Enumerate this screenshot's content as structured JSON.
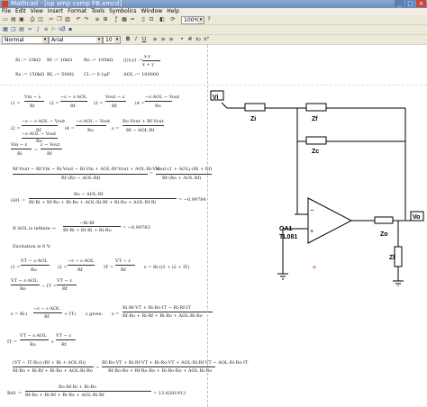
{
  "window": {
    "title": "Mathcad - [op amp comp FB.xmcd]"
  },
  "menu": [
    "File",
    "Edit",
    "View",
    "Insert",
    "Format",
    "Tools",
    "Symbolics",
    "Window",
    "Help"
  ],
  "toolbar": {
    "zoom": "100%",
    "style": "Normal",
    "font": "Arial",
    "size": "10",
    "bold": "B",
    "italic": "I",
    "underline": "U"
  },
  "defs": {
    "Ri": "Ri := 10kΩ",
    "Rf": "Rf := 10kΩ",
    "Ro": "Ro := 100kΩ",
    "par": "||(x,y) :=",
    "par_num": "x·y",
    "par_den": "x + y",
    "Rs": "Rs := 150kΩ",
    "RL": "RL := 500Ω",
    "Cl": "Cl := 0.1µF",
    "AOL": "AOL := 100000"
  },
  "eqs": {
    "i1": "i1 =",
    "i1n": "Vin − ε",
    "i1d": "Ri",
    "i2": "i2 =",
    "i2n": "−ε − ε·AOL",
    "i2d": "Rf",
    "i3": "i3 =",
    "i3n": "Vout − ε",
    "i3d": "Rf",
    "i4": "i4 =",
    "i4n": "−ε·AOL − Vout",
    "i4d": "Ro",
    "r2a": "i2 =",
    "r2an": "−ε − ε·AOL − Vout",
    "r2ad": "Rf",
    "r2b": "i4 =",
    "r2bn": "−ε·AOL − Vout",
    "r2bd": "Ro",
    "r2c": "ε =",
    "r2cn": "Ro·Vout + Rf·Vout",
    "r2cd": "Rf − AOL·Rf",
    "r3n": "Vin − ε",
    "r3d": "Ri",
    "r3e": "=",
    "r3n2": "ε − Vout",
    "r3d2": "Rf",
    "big1n": "Rf·Vout − Rf·Vin − Ri·Vout − Ri·Vin + AOL·Rf·Vout + AOL·Ri·Vin",
    "big1d": "Rf·(Ro − AOL·Rf)",
    "big1r": "Vout·(1 + AOL)·(Ri + Rf)",
    "big1rd": "Rf·(Ro + AOL·Rf)",
    "g": "G01 =",
    "gn": "Ro − AOL·Rf",
    "gd": "Rf·Ri + Rf·Ro + Ri·Ro + AOL·Ri·Rf + Ri·Ro + AOL·Rf·Ri",
    "gres": "= −0.99784",
    "aol": "If AOL is infinite →",
    "aoln": "−Ri·Rf",
    "aold": "Rf·Ri + Rf·Ri + Ri·Ro",
    "aolres": "= −0.99783",
    "exc": "Excitation is 0 V:",
    "e1": "i1 =",
    "e1n": "VT − ε·AOL",
    "e1d": "Ro",
    "e2": "i2 =",
    "e2n": "−ε − ε·AOL",
    "e2d": "Rf",
    "e3": "IT =",
    "e3n": "VT − ε",
    "e3d": "Rf",
    "e4": "ε = Ri·(i1 + i2 + IT)",
    "f1n": "VT − ε·AOL",
    "f1d": "Ro",
    "f1m": "− IT =",
    "f1n2": "VT − ε",
    "f1d2": "Rf",
    "f2": "ε = Ri·(",
    "f2n": "−ε − ε·AOL",
    "f2d": "Rf",
    "f2m": "+ IT)",
    "f2g": "ε gives:",
    "f2r": "ε =",
    "f2rn": "Ri·Rf·VT + Ri·Ro·IT − Ri·Rf·IT",
    "f2rd": "Rf·Ro + Ri·Rf + Ri·Ro + AOL·Ri·Ro",
    "h1": "IT =",
    "h1n": "VT − ε·AOL",
    "h1d": "Ro",
    "h1p": "+",
    "h1n2": "VT − ε",
    "h1d2": "Rf",
    "h2n": "(VT − IT·Ro)·(Rf + Ri + AOL·Ri)",
    "h2d": "Rf·Ro + Ri·Rf + Ri·Ro + AOL·Ri·Ro",
    "h2r": "=",
    "h2rn": "Rf·Ro·VT + Ri·Rf·VT + Ri·Ro·VT + AOL·Ri·Rf·VT − AOL·Ri·Ro·IT",
    "h2rd": "Rf·Ro·Ro + Rf·Ro·Ro + Ri·Ro·Ro + AOL·Ri·Ro",
    "ro": "Rd1 =",
    "ron": "Ro·Rf·Ri + Ri·Ro",
    "rod": "Rf·Ro + Ri·Rf + Ri·Ro + AOL·Ri·Rf",
    "rores": "= 13.8281913"
  },
  "schematic": {
    "vi": "Vi",
    "vo": "Vo",
    "zi": "Zi",
    "zf": "Zf",
    "zc": "Zc",
    "zo": "Zo",
    "zl": "Zl",
    "opamp": "OA1",
    "model": "TL081",
    "minus": "−",
    "plus": "+"
  }
}
